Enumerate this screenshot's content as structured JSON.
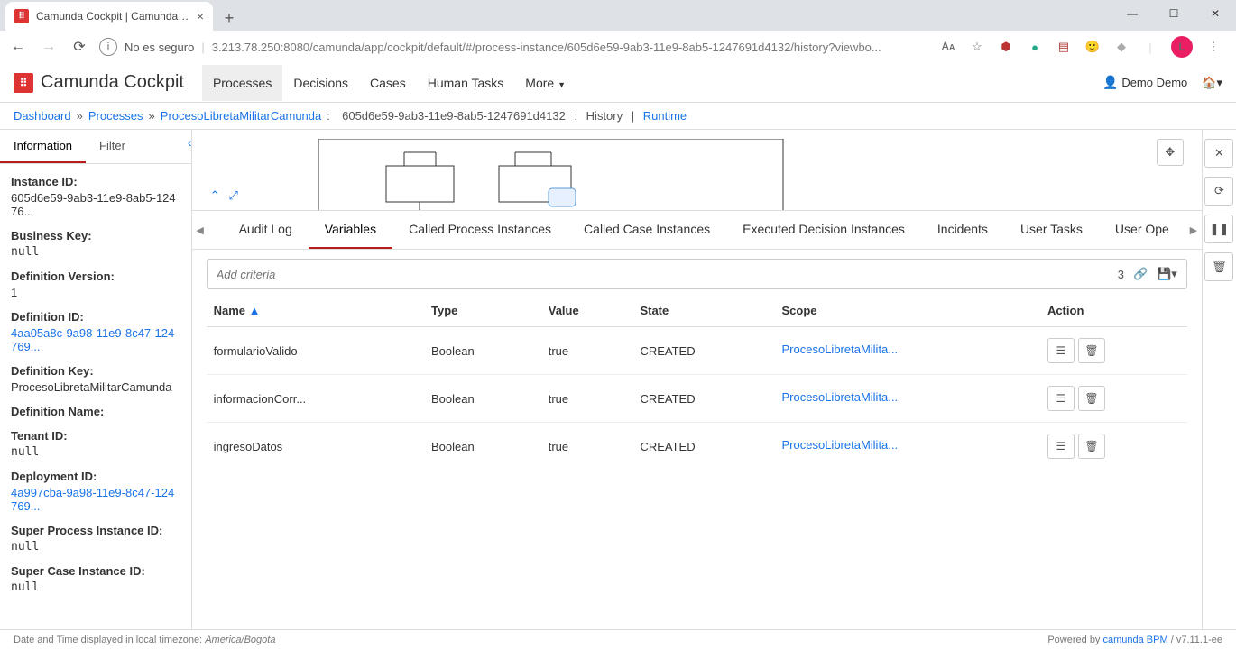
{
  "browser": {
    "tab_title": "Camunda Cockpit | Camunda Co",
    "url_prefix": "No es seguro",
    "url": "3.213.78.250:8080/camunda/app/cockpit/default/#/process-instance/605d6e59-9ab3-11e9-8ab5-1247691d4132/history?viewbo...",
    "avatar_letter": "L"
  },
  "header": {
    "app_name": "Camunda Cockpit",
    "nav": [
      "Processes",
      "Decisions",
      "Cases",
      "Human Tasks",
      "More"
    ],
    "active_nav_index": 0,
    "user": "Demo Demo"
  },
  "breadcrumb": {
    "dashboard": "Dashboard",
    "processes": "Processes",
    "definition": "ProcesoLibretaMilitarCamunda",
    "instance_id": "605d6e59-9ab3-11e9-8ab5-1247691d4132",
    "history": "History",
    "runtime": "Runtime"
  },
  "left_panel": {
    "tabs": [
      "Information",
      "Filter"
    ],
    "active_tab_index": 0,
    "items": [
      {
        "label": "Instance ID:",
        "value": "605d6e59-9ab3-11e9-8ab5-12476...",
        "type": "text"
      },
      {
        "label": "Business Key:",
        "value": "null",
        "type": "mono"
      },
      {
        "label": "Definition Version:",
        "value": "1",
        "type": "text"
      },
      {
        "label": "Definition ID:",
        "value": "4aa05a8c-9a98-11e9-8c47-124769...",
        "type": "link"
      },
      {
        "label": "Definition Key:",
        "value": "ProcesoLibretaMilitarCamunda",
        "type": "text"
      },
      {
        "label": "Definition Name:",
        "value": "",
        "type": "text"
      },
      {
        "label": "Tenant ID:",
        "value": "null",
        "type": "mono"
      },
      {
        "label": "Deployment ID:",
        "value": "4a997cba-9a98-11e9-8c47-124769...",
        "type": "link"
      },
      {
        "label": "Super Process Instance ID:",
        "value": "null",
        "type": "mono"
      },
      {
        "label": "Super Case Instance ID:",
        "value": "null",
        "type": "mono"
      }
    ]
  },
  "detail_tabs": [
    "Audit Log",
    "Variables",
    "Called Process Instances",
    "Called Case Instances",
    "Executed Decision Instances",
    "Incidents",
    "User Tasks",
    "User Ope"
  ],
  "active_detail_tab_index": 1,
  "criteria": {
    "placeholder": "Add criteria",
    "count": "3"
  },
  "table": {
    "headers": [
      "Name",
      "Type",
      "Value",
      "State",
      "Scope",
      "Action"
    ],
    "sort_col": 0,
    "rows": [
      {
        "name": "formularioValido",
        "type": "Boolean",
        "value": "true",
        "state": "CREATED",
        "scope": "ProcesoLibretaMilita..."
      },
      {
        "name": "informacionCorr...",
        "type": "Boolean",
        "value": "true",
        "state": "CREATED",
        "scope": "ProcesoLibretaMilita..."
      },
      {
        "name": "ingresoDatos",
        "type": "Boolean",
        "value": "true",
        "state": "CREATED",
        "scope": "ProcesoLibretaMilita..."
      }
    ]
  },
  "footer": {
    "tz_label": "Date and Time displayed in local timezone:",
    "tz": "America/Bogota",
    "powered": "Powered by",
    "link": "camunda BPM",
    "version": "/ v7.11.1-ee"
  }
}
